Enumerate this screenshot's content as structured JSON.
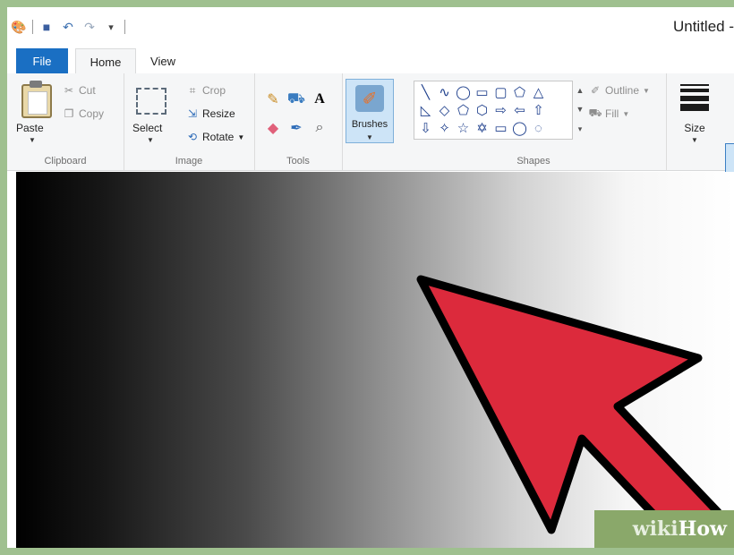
{
  "window": {
    "title": "Untitled -"
  },
  "quick_access": {
    "icons": [
      "paint-app-icon",
      "save-icon",
      "undo-icon",
      "redo-icon",
      "customize-dropdown-icon"
    ]
  },
  "tabs": {
    "file": "File",
    "home": "Home",
    "view": "View"
  },
  "ribbon": {
    "clipboard": {
      "paste": "Paste",
      "cut": "Cut",
      "copy": "Copy",
      "label": "Clipboard"
    },
    "image": {
      "select": "Select",
      "crop": "Crop",
      "resize": "Resize",
      "rotate": "Rotate",
      "label": "Image"
    },
    "tools": {
      "label": "Tools",
      "icons": [
        "pencil-icon",
        "fill-icon",
        "text-icon",
        "eraser-icon",
        "color-picker-icon",
        "magnifier-icon"
      ]
    },
    "brushes": {
      "label": "Brushes"
    },
    "shapes": {
      "outline": "Outline",
      "fill": "Fill",
      "label": "Shapes"
    },
    "size": {
      "label": "Size"
    }
  },
  "canvas": {
    "description_colors": {
      "arrow_fill": "#dc2a3c",
      "arrow_stroke": "#000000"
    }
  },
  "watermark": {
    "wiki": "wiki",
    "how": "How"
  },
  "colors": {
    "file_tab": "#1a6fc3",
    "ribbon_bg": "#f5f6f7",
    "selected_tool": "#cde4f7"
  }
}
